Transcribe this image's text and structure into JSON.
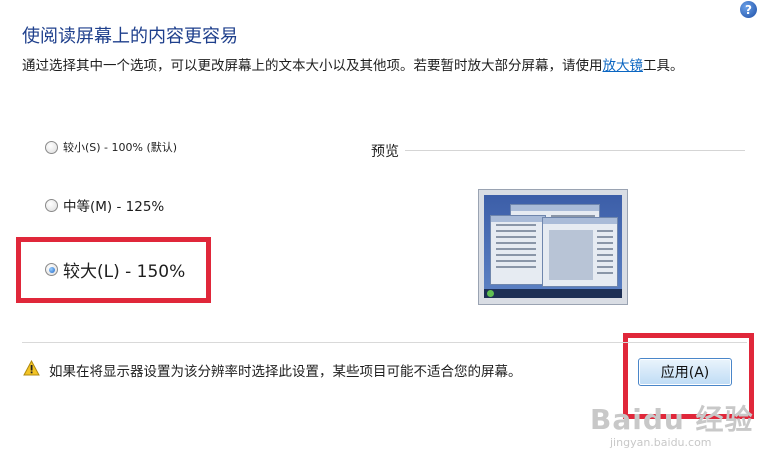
{
  "header": {
    "title": "使阅读屏幕上的内容更容易",
    "help_glyph": "?"
  },
  "description": {
    "text": "通过选择其中一个选项，可以更改屏幕上的文本大小以及其他项。若要暂时放大部分屏幕，请使用",
    "link": "放大镜",
    "suffix": "工具。"
  },
  "options": [
    {
      "label": "较小(S) - 100% (默认)",
      "selected": false
    },
    {
      "label": "中等(M) - 125%",
      "selected": false
    },
    {
      "label": "较大(L) - 150%",
      "selected": true
    }
  ],
  "preview": {
    "label": "预览"
  },
  "warning": {
    "icon": "warning-icon",
    "text": "如果在将显示器设置为该分辨率时选择此设置，某些项目可能不适合您的屏幕。"
  },
  "buttons": {
    "apply": "应用(A)"
  },
  "watermark": {
    "logo": "Baidu 经验",
    "url": "jingyan.baidu.com"
  },
  "colors": {
    "title": "#1e3f8c",
    "link": "#0b66c2",
    "highlight": "#e0273a"
  }
}
